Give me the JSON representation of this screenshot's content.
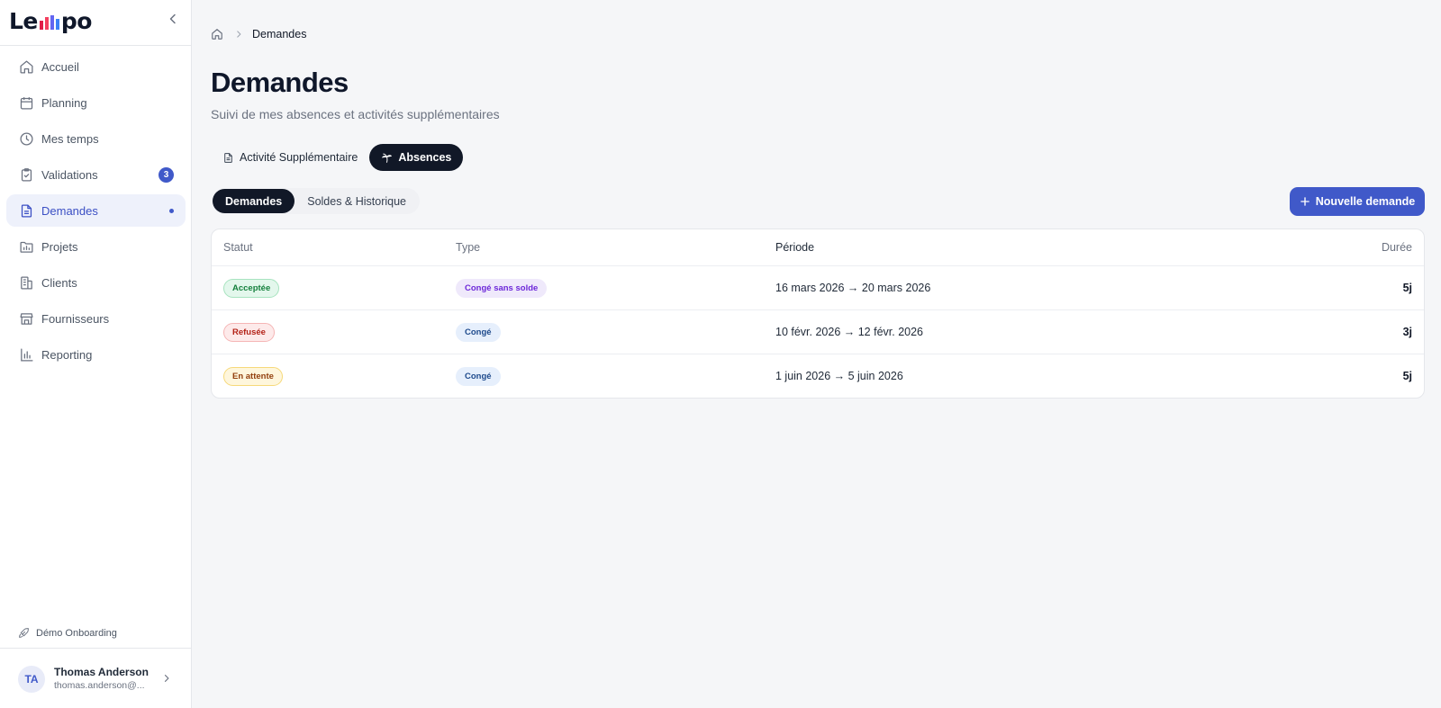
{
  "app": {
    "logo_text_start": "Le",
    "logo_text_end": "po"
  },
  "sidebar": {
    "items": [
      {
        "label": "Accueil",
        "icon": "home-icon"
      },
      {
        "label": "Planning",
        "icon": "calendar-icon"
      },
      {
        "label": "Mes temps",
        "icon": "clock-icon"
      },
      {
        "label": "Validations",
        "icon": "clipboard-check-icon",
        "badge": "3"
      },
      {
        "label": "Demandes",
        "icon": "file-text-icon",
        "active": true
      },
      {
        "label": "Projets",
        "icon": "folder-chart-icon"
      },
      {
        "label": "Clients",
        "icon": "building-icon"
      },
      {
        "label": "Fournisseurs",
        "icon": "store-icon"
      },
      {
        "label": "Reporting",
        "icon": "bar-chart-icon"
      }
    ],
    "onboarding_label": "Démo Onboarding",
    "user": {
      "initials": "TA",
      "name": "Thomas Anderson",
      "email": "thomas.anderson@..."
    }
  },
  "breadcrumb": {
    "current": "Demandes"
  },
  "page": {
    "title": "Demandes",
    "subtitle": "Suivi de mes absences et activités supplémentaires"
  },
  "main_tabs": [
    {
      "label": "Activité Supplémentaire",
      "active": false
    },
    {
      "label": "Absences",
      "active": true
    }
  ],
  "sub_tabs": [
    {
      "label": "Demandes",
      "active": true
    },
    {
      "label": "Soldes & Historique",
      "active": false
    }
  ],
  "new_request_label": "Nouvelle demande",
  "table": {
    "headers": {
      "status": "Statut",
      "type": "Type",
      "period": "Période",
      "duration": "Durée"
    },
    "rows": [
      {
        "status": "Acceptée",
        "type": "Congé sans solde",
        "period": "16 mars 2026 → 20 mars 2026",
        "duration": "5j"
      },
      {
        "status": "Refusée",
        "type": "Congé",
        "period": "10 févr. 2026 → 12 févr. 2026",
        "duration": "3j"
      },
      {
        "status": "En attente",
        "type": "Congé",
        "period": "1 juin 2026 → 5 juin 2026",
        "duration": "5j"
      }
    ]
  },
  "colors": {
    "accent": "#4059c9",
    "dark": "#111827",
    "status_accepted": "#15803d",
    "status_refused": "#b42318",
    "status_pending": "#92400e"
  }
}
